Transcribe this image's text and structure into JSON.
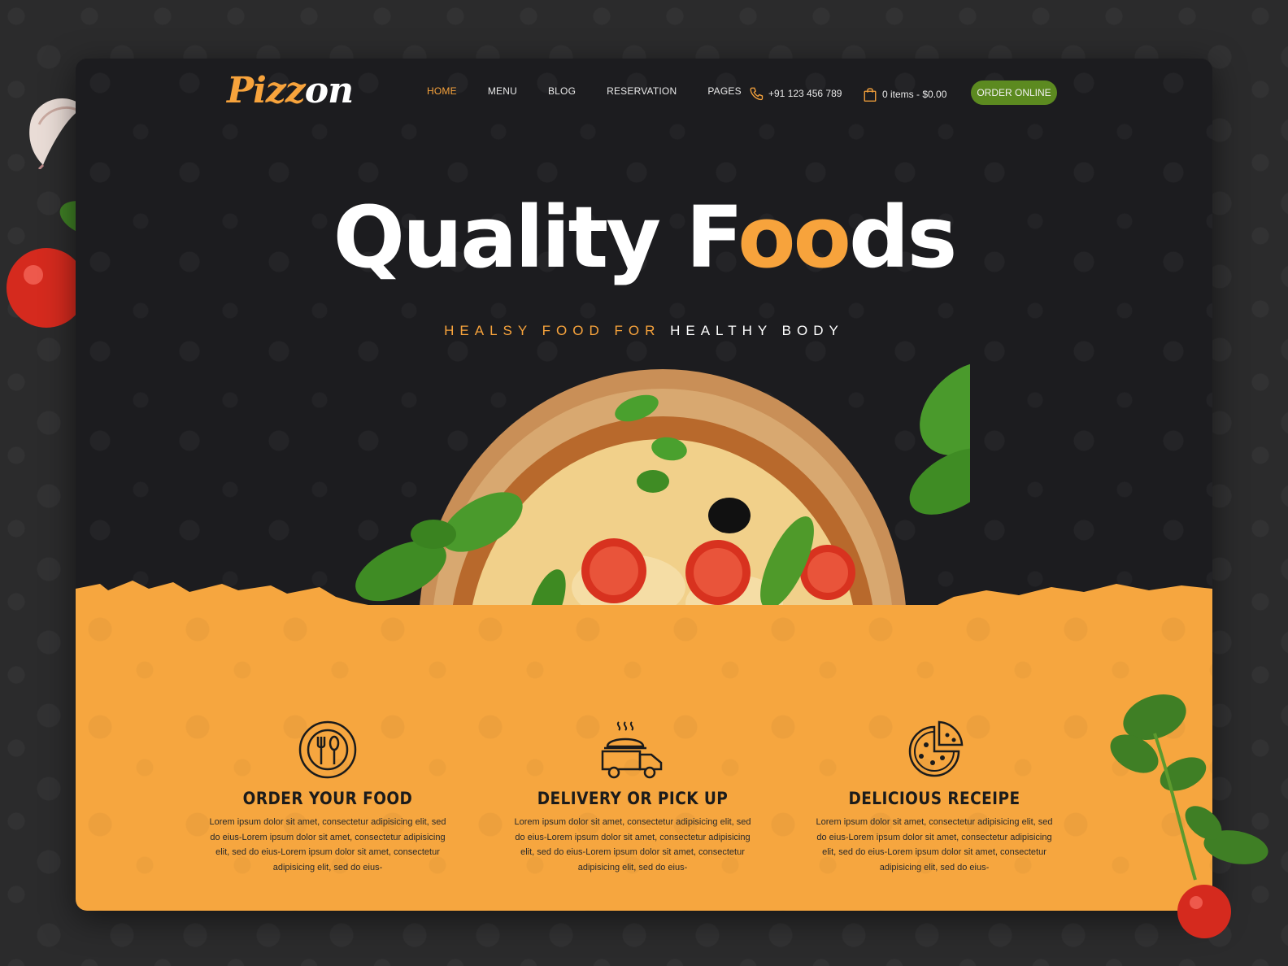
{
  "brand": {
    "logo_part1": "Pizz",
    "logo_part2": "on",
    "accent_color": "#f7a33c",
    "button_color": "#5c8a20",
    "feature_bg_color": "#f6a63f"
  },
  "nav": {
    "items": [
      {
        "label": "HOME",
        "active": true
      },
      {
        "label": "MENU",
        "active": false
      },
      {
        "label": "BLOG",
        "active": false
      },
      {
        "label": "RESERVATION",
        "active": false
      },
      {
        "label": "PAGES",
        "active": false
      }
    ]
  },
  "header": {
    "phone_icon": "phone-icon",
    "phone": "+91 123 456 789",
    "cart_icon": "shopping-bag-icon",
    "cart": "0 items - $0.00",
    "order_button": "ORDER ONLINE"
  },
  "hero": {
    "title_part1": "Quality F",
    "title_part2": "oo",
    "title_part3": "ds",
    "tagline_part1": "HEALSY FOOD FOR ",
    "tagline_part2": "HEALTHY BODY"
  },
  "features": [
    {
      "icon": "plate-cutlery-icon",
      "title": "ORDER YOUR FOOD",
      "text": "Lorem ipsum dolor sit amet, consectetur adipisicing elit, sed do eius-Lorem ipsum dolor sit amet, consectetur adipisicing elit, sed do eius-Lorem ipsum dolor sit amet, consectetur adipisicing elit, sed do eius-"
    },
    {
      "icon": "delivery-truck-icon",
      "title": "DELIVERY OR PICK UP",
      "text": "Lorem ipsum dolor sit amet, consectetur adipisicing elit, sed do eius-Lorem ipsum dolor sit amet, consectetur adipisicing elit, sed do eius-Lorem ipsum dolor sit amet, consectetur adipisicing elit, sed do eius-"
    },
    {
      "icon": "pizza-icon",
      "title": "DELICIOUS RECEIPE",
      "text": "Lorem ipsum dolor sit amet, consectetur adipisicing elit, sed do eius-Lorem ipsum dolor sit amet, consectetur adipisicing elit, sed do eius-Lorem ipsum dolor sit amet, consectetur adipisicing elit, sed do eius-"
    }
  ]
}
